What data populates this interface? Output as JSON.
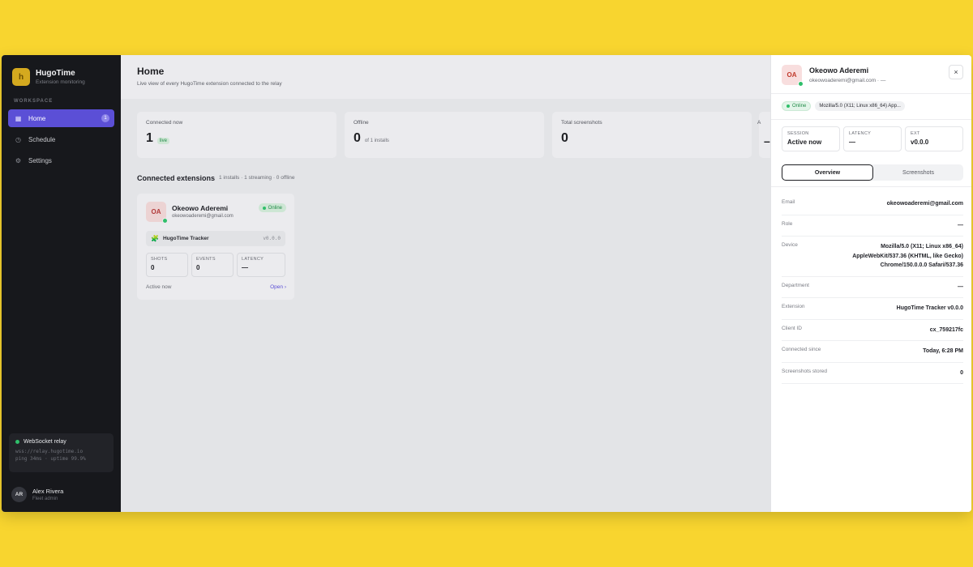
{
  "app": {
    "name": "HugoTime",
    "subtitle": "Extension monitoring",
    "logo_letter": "h"
  },
  "sidebar": {
    "section_label": "WORKSPACE",
    "items": [
      {
        "label": "Home",
        "badge": "1",
        "active": true
      },
      {
        "label": "Schedule"
      },
      {
        "label": "Settings"
      }
    ],
    "relay": {
      "title": "WebSocket relay",
      "url": "wss://relay.hugotime.io",
      "stats": "ping 34ms · uptime 99.9%"
    },
    "user": {
      "initials": "AR",
      "name": "Alex Rivera",
      "role": "Fleet admin"
    }
  },
  "main": {
    "title": "Home",
    "subtitle": "Live view of every HugoTime extension connected to the relay",
    "stats": [
      {
        "label": "Connected now",
        "value": "1",
        "note": "live"
      },
      {
        "label": "Offline",
        "value": "0",
        "note": "of 1 installs"
      },
      {
        "label": "Total screenshots",
        "value": "0"
      },
      {
        "label": "A",
        "value": "–"
      }
    ],
    "connected": {
      "title": "Connected extensions",
      "subtitle": "1 installs · 1 streaming · 0 offline",
      "cards": [
        {
          "initials": "OA",
          "name": "Okeowo Aderemi",
          "email": "okeowoaderemi@gmail.com",
          "status": "Online",
          "extension": "HugoTime Tracker",
          "version": "v0.0.0",
          "metrics": [
            {
              "label": "SHOTS",
              "value": "0"
            },
            {
              "label": "EVENTS",
              "value": "0"
            },
            {
              "label": "LATENCY",
              "value": "—"
            }
          ],
          "footer": "Active now",
          "open_label": "Open ›"
        }
      ]
    }
  },
  "panel": {
    "initials": "OA",
    "name": "Okeowo Aderemi",
    "email_line": "okeowoaderemi@gmail.com · —",
    "status": "Online",
    "user_agent_chip": "Mozilla/5.0 (X11; Linux x86_64) App...",
    "close_icon": "×",
    "minis": [
      {
        "label": "SESSION",
        "value": "Active now"
      },
      {
        "label": "LATENCY",
        "value": "—"
      },
      {
        "label": "EXT",
        "value": "v0.0.0"
      }
    ],
    "tabs": [
      {
        "label": "Overview",
        "active": true
      },
      {
        "label": "Screenshots"
      }
    ],
    "details": [
      {
        "label": "Email",
        "value": "okeowoaderemi@gmail.com"
      },
      {
        "label": "Role",
        "value": "—"
      },
      {
        "label": "Device",
        "value": "Mozilla/5.0 (X11; Linux x86_64) AppleWebKit/537.36 (KHTML, like Gecko) Chrome/150.0.0.0 Safari/537.36"
      },
      {
        "label": "Department",
        "value": "—"
      },
      {
        "label": "Extension",
        "value": "HugoTime Tracker v0.0.0"
      },
      {
        "label": "Client ID",
        "value": "cx_759217fc"
      },
      {
        "label": "Connected since",
        "value": "Today, 6:28 PM"
      },
      {
        "label": "Screenshots stored",
        "value": "0"
      }
    ]
  },
  "colors": {
    "background": "#f8d52f",
    "accent": "#5b4fd6",
    "online": "#2fbf6a",
    "sidebar": "#17181c"
  },
  "icons": {
    "home": "home-icon",
    "schedule": "clock-icon",
    "settings": "gear-icon",
    "extension": "puzzle-icon",
    "close": "close-icon"
  }
}
